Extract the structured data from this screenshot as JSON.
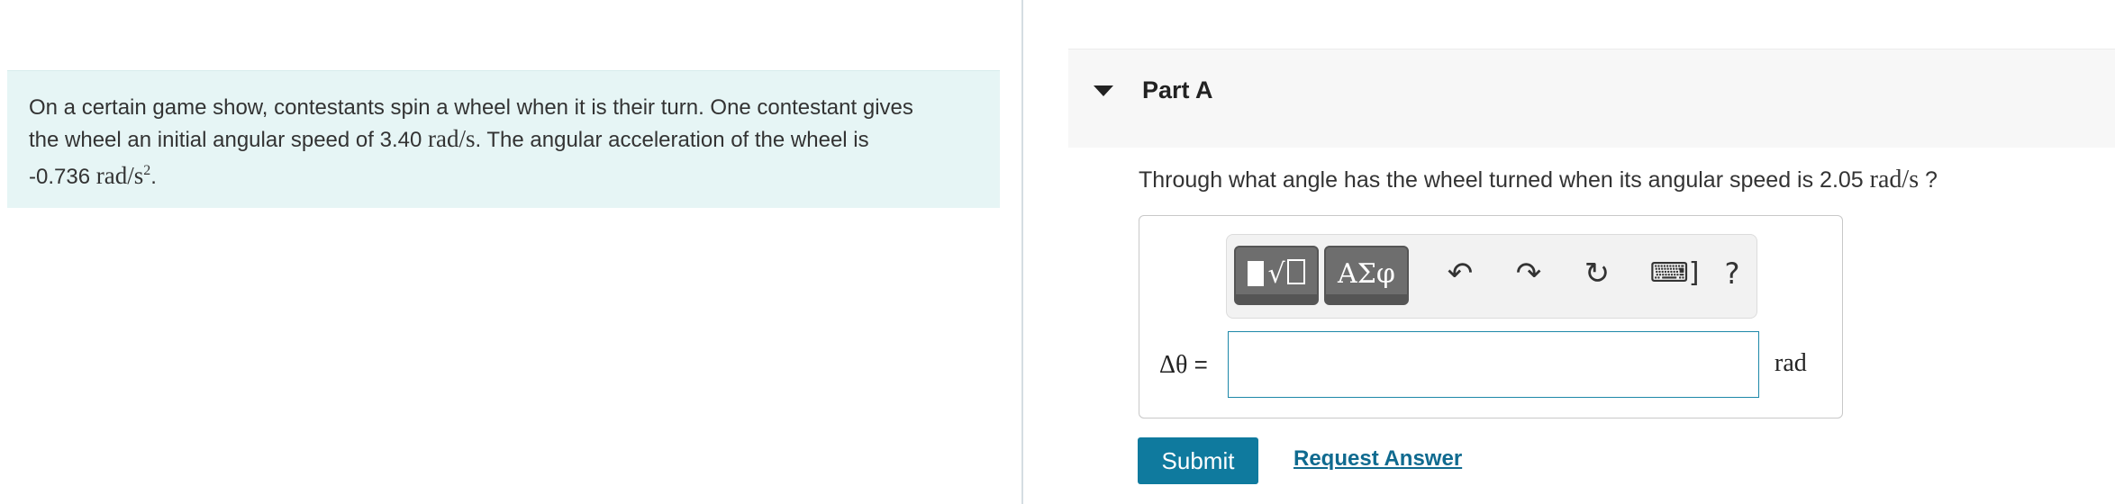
{
  "problem": {
    "line1": "On a certain game show, contestants spin a wheel when it is their turn. One contestant gives",
    "line2_prefix": "the wheel an initial angular speed of 3.40 ",
    "line2_unit": "rad/s",
    "line2_suffix": ". The angular acceleration of the wheel is",
    "line3_value": "-0.736 ",
    "line3_unit": "rad/s",
    "line3_exp": "2",
    "line3_suffix": "."
  },
  "part": {
    "title": "Part A",
    "caret_icon": "caret-down-icon"
  },
  "question": {
    "prefix": "Through what angle has the wheel turned when its angular speed is 2.05 ",
    "unit": "rad/s",
    "suffix": " ?"
  },
  "toolbar": {
    "symbols_label": "ΑΣφ",
    "templates_icon": "templates-icon",
    "undo_icon": "undo-icon",
    "redo_icon": "redo-icon",
    "reset_icon": "reset-icon",
    "keyboard_label": "⌨]",
    "help_label": "?"
  },
  "answer": {
    "label_symbol": "Δθ",
    "label_equals": " =",
    "value": "",
    "unit": "rad"
  },
  "actions": {
    "submit_label": "Submit",
    "request_label": "Request Answer"
  },
  "colors": {
    "accent": "#0f7a9e",
    "problem_bg": "#e6f5f5",
    "header_bg": "#f7f7f7"
  }
}
